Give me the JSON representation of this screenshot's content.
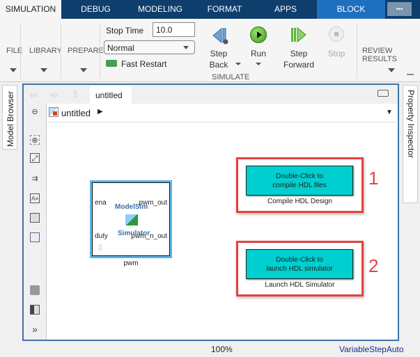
{
  "tabs": [
    {
      "label": "SIMULATION",
      "active": true
    },
    {
      "label": "DEBUG"
    },
    {
      "label": "MODELING"
    },
    {
      "label": "FORMAT"
    },
    {
      "label": "APPS"
    },
    {
      "label": "BLOCK",
      "contextual": true
    }
  ],
  "more_label": "•••",
  "ribbon": {
    "file": "FILE",
    "library": "LIBRARY",
    "prepare": "PREPARE",
    "stop_time_label": "Stop Time",
    "stop_time_value": "10.0",
    "mode_value": "Normal",
    "fast_restart": "Fast Restart",
    "step_back": [
      "Step",
      "Back"
    ],
    "run": "Run",
    "step_forward": [
      "Step",
      "Forward"
    ],
    "stop": "Stop",
    "simulate_group": "SIMULATE",
    "review_results": "REVIEW RESULTS"
  },
  "side_tabs": {
    "left": "Model Browser",
    "right": "Property Inspector"
  },
  "editor": {
    "tab": "untitled",
    "breadcrumb": "untitled"
  },
  "pwm_block": {
    "ports_in": [
      "ena",
      "duty"
    ],
    "ports_out": [
      "pwm_out",
      "pwm_n_out"
    ],
    "title1": "ModelSim",
    "title2": "Simulator",
    "name": "pwm"
  },
  "compile_block": {
    "line1": "Double-Click to",
    "line2": "compile HDL files",
    "caption": "Compile HDL Design",
    "number": "1"
  },
  "launch_block": {
    "line1": "Double-Click to",
    "line2": "launch HDL simulator",
    "caption": "Launch HDL Simulator",
    "number": "2"
  },
  "status": {
    "zoom": "100%",
    "solver": "VariableStepAuto"
  },
  "colors": {
    "tabbar": "#0e3e6c",
    "block_tab": "#1f6fbf",
    "highlight": "#e8403f",
    "annotation_fill": "#00cfcf",
    "frame": "#3f72a8"
  }
}
